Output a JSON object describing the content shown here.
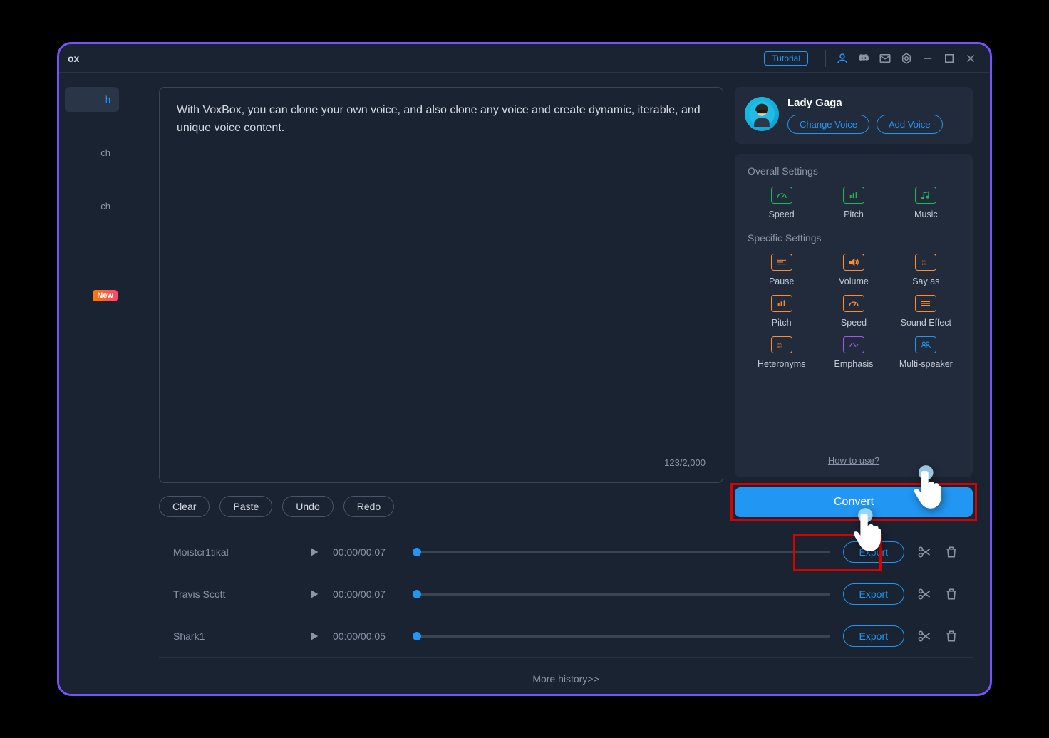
{
  "titlebar": {
    "app_name": "ox",
    "tutorial_label": "Tutorial"
  },
  "sidebar": {
    "items": [
      {
        "label": "h",
        "active": true
      },
      {
        "label": "ch"
      },
      {
        "label": "ch"
      },
      {
        "label": ""
      }
    ],
    "new_badge": "New"
  },
  "editor": {
    "text": "With VoxBox, you can clone your own voice, and also clone any voice and create dynamic, iterable, and unique voice content.",
    "char_count": "123/2,000",
    "buttons": {
      "clear": "Clear",
      "paste": "Paste",
      "undo": "Undo",
      "redo": "Redo"
    }
  },
  "voice": {
    "name": "Lady Gaga",
    "change_label": "Change Voice",
    "add_label": "Add Voice"
  },
  "settings": {
    "overall_header": "Overall Settings",
    "specific_header": "Specific Settings",
    "overall": [
      {
        "label": "Speed",
        "icon": "speedometer",
        "color": "green"
      },
      {
        "label": "Pitch",
        "icon": "bars",
        "color": "green"
      },
      {
        "label": "Music",
        "icon": "music",
        "color": "green"
      }
    ],
    "specific": [
      {
        "label": "Pause",
        "icon": "pause",
        "color": "orange"
      },
      {
        "label": "Volume",
        "icon": "volume",
        "color": "orange"
      },
      {
        "label": "Say as",
        "icon": "sayas",
        "color": "orange"
      },
      {
        "label": "Pitch",
        "icon": "bars",
        "color": "orange"
      },
      {
        "label": "Speed",
        "icon": "speedometer",
        "color": "orange"
      },
      {
        "label": "Sound Effect",
        "icon": "lines",
        "color": "orange"
      },
      {
        "label": "Heteronyms",
        "icon": "abc",
        "color": "orange"
      },
      {
        "label": "Emphasis",
        "icon": "emphasis",
        "color": "purple"
      },
      {
        "label": "Multi-speaker",
        "icon": "people",
        "color": "blue"
      }
    ],
    "how_link": "How to use?"
  },
  "convert_label": "Convert",
  "history": {
    "rows": [
      {
        "name": "Moistcr1tikal",
        "time": "00:00/00:07",
        "export": "Export"
      },
      {
        "name": "Travis Scott",
        "time": "00:00/00:07",
        "export": "Export"
      },
      {
        "name": "Shark1",
        "time": "00:00/00:05",
        "export": "Export"
      }
    ],
    "more": "More history>>"
  }
}
